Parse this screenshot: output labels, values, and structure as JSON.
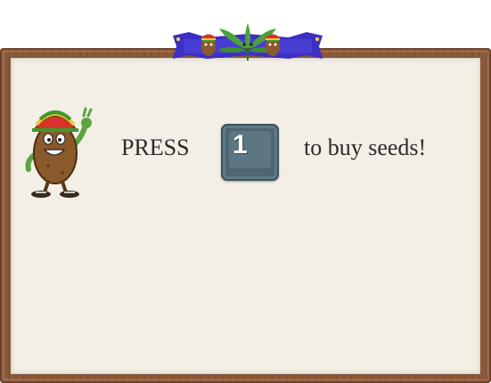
{
  "prompt": {
    "prefix": "PRESS",
    "key_label": "1",
    "suffix": "to buy seeds!"
  },
  "colors": {
    "frame_wood": "#8a5a3a",
    "board_paper": "#f3efe7",
    "key_body": "#4d6672",
    "banner_ribbon": "#3b2fc4",
    "leaf_green": "#4aa23a"
  },
  "icons": {
    "banner": "cannabis-leaf-banner-icon",
    "character": "rasta-potato-mascot-icon"
  }
}
